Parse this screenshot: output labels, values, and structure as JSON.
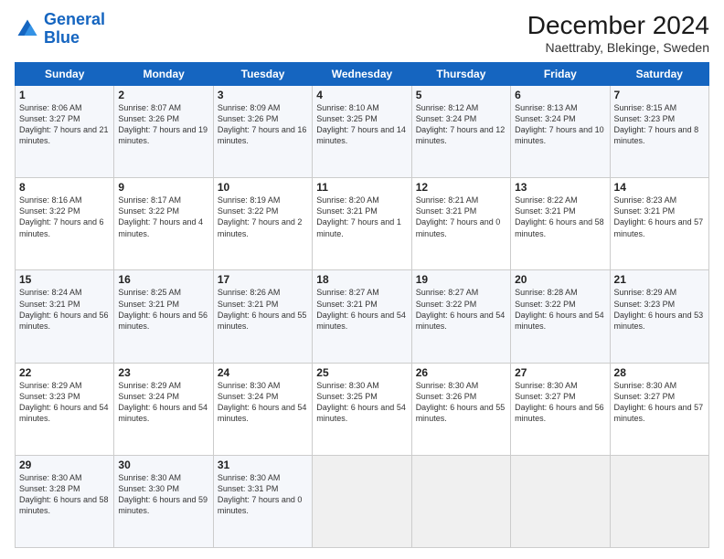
{
  "logo": {
    "line1": "General",
    "line2": "Blue"
  },
  "title": "December 2024",
  "subtitle": "Naettraby, Blekinge, Sweden",
  "days_header": [
    "Sunday",
    "Monday",
    "Tuesday",
    "Wednesday",
    "Thursday",
    "Friday",
    "Saturday"
  ],
  "weeks": [
    [
      {
        "day": "1",
        "sunrise": "Sunrise: 8:06 AM",
        "sunset": "Sunset: 3:27 PM",
        "daylight": "Daylight: 7 hours and 21 minutes."
      },
      {
        "day": "2",
        "sunrise": "Sunrise: 8:07 AM",
        "sunset": "Sunset: 3:26 PM",
        "daylight": "Daylight: 7 hours and 19 minutes."
      },
      {
        "day": "3",
        "sunrise": "Sunrise: 8:09 AM",
        "sunset": "Sunset: 3:26 PM",
        "daylight": "Daylight: 7 hours and 16 minutes."
      },
      {
        "day": "4",
        "sunrise": "Sunrise: 8:10 AM",
        "sunset": "Sunset: 3:25 PM",
        "daylight": "Daylight: 7 hours and 14 minutes."
      },
      {
        "day": "5",
        "sunrise": "Sunrise: 8:12 AM",
        "sunset": "Sunset: 3:24 PM",
        "daylight": "Daylight: 7 hours and 12 minutes."
      },
      {
        "day": "6",
        "sunrise": "Sunrise: 8:13 AM",
        "sunset": "Sunset: 3:24 PM",
        "daylight": "Daylight: 7 hours and 10 minutes."
      },
      {
        "day": "7",
        "sunrise": "Sunrise: 8:15 AM",
        "sunset": "Sunset: 3:23 PM",
        "daylight": "Daylight: 7 hours and 8 minutes."
      }
    ],
    [
      {
        "day": "8",
        "sunrise": "Sunrise: 8:16 AM",
        "sunset": "Sunset: 3:22 PM",
        "daylight": "Daylight: 7 hours and 6 minutes."
      },
      {
        "day": "9",
        "sunrise": "Sunrise: 8:17 AM",
        "sunset": "Sunset: 3:22 PM",
        "daylight": "Daylight: 7 hours and 4 minutes."
      },
      {
        "day": "10",
        "sunrise": "Sunrise: 8:19 AM",
        "sunset": "Sunset: 3:22 PM",
        "daylight": "Daylight: 7 hours and 2 minutes."
      },
      {
        "day": "11",
        "sunrise": "Sunrise: 8:20 AM",
        "sunset": "Sunset: 3:21 PM",
        "daylight": "Daylight: 7 hours and 1 minute."
      },
      {
        "day": "12",
        "sunrise": "Sunrise: 8:21 AM",
        "sunset": "Sunset: 3:21 PM",
        "daylight": "Daylight: 7 hours and 0 minutes."
      },
      {
        "day": "13",
        "sunrise": "Sunrise: 8:22 AM",
        "sunset": "Sunset: 3:21 PM",
        "daylight": "Daylight: 6 hours and 58 minutes."
      },
      {
        "day": "14",
        "sunrise": "Sunrise: 8:23 AM",
        "sunset": "Sunset: 3:21 PM",
        "daylight": "Daylight: 6 hours and 57 minutes."
      }
    ],
    [
      {
        "day": "15",
        "sunrise": "Sunrise: 8:24 AM",
        "sunset": "Sunset: 3:21 PM",
        "daylight": "Daylight: 6 hours and 56 minutes."
      },
      {
        "day": "16",
        "sunrise": "Sunrise: 8:25 AM",
        "sunset": "Sunset: 3:21 PM",
        "daylight": "Daylight: 6 hours and 56 minutes."
      },
      {
        "day": "17",
        "sunrise": "Sunrise: 8:26 AM",
        "sunset": "Sunset: 3:21 PM",
        "daylight": "Daylight: 6 hours and 55 minutes."
      },
      {
        "day": "18",
        "sunrise": "Sunrise: 8:27 AM",
        "sunset": "Sunset: 3:21 PM",
        "daylight": "Daylight: 6 hours and 54 minutes."
      },
      {
        "day": "19",
        "sunrise": "Sunrise: 8:27 AM",
        "sunset": "Sunset: 3:22 PM",
        "daylight": "Daylight: 6 hours and 54 minutes."
      },
      {
        "day": "20",
        "sunrise": "Sunrise: 8:28 AM",
        "sunset": "Sunset: 3:22 PM",
        "daylight": "Daylight: 6 hours and 54 minutes."
      },
      {
        "day": "21",
        "sunrise": "Sunrise: 8:29 AM",
        "sunset": "Sunset: 3:23 PM",
        "daylight": "Daylight: 6 hours and 53 minutes."
      }
    ],
    [
      {
        "day": "22",
        "sunrise": "Sunrise: 8:29 AM",
        "sunset": "Sunset: 3:23 PM",
        "daylight": "Daylight: 6 hours and 54 minutes."
      },
      {
        "day": "23",
        "sunrise": "Sunrise: 8:29 AM",
        "sunset": "Sunset: 3:24 PM",
        "daylight": "Daylight: 6 hours and 54 minutes."
      },
      {
        "day": "24",
        "sunrise": "Sunrise: 8:30 AM",
        "sunset": "Sunset: 3:24 PM",
        "daylight": "Daylight: 6 hours and 54 minutes."
      },
      {
        "day": "25",
        "sunrise": "Sunrise: 8:30 AM",
        "sunset": "Sunset: 3:25 PM",
        "daylight": "Daylight: 6 hours and 54 minutes."
      },
      {
        "day": "26",
        "sunrise": "Sunrise: 8:30 AM",
        "sunset": "Sunset: 3:26 PM",
        "daylight": "Daylight: 6 hours and 55 minutes."
      },
      {
        "day": "27",
        "sunrise": "Sunrise: 8:30 AM",
        "sunset": "Sunset: 3:27 PM",
        "daylight": "Daylight: 6 hours and 56 minutes."
      },
      {
        "day": "28",
        "sunrise": "Sunrise: 8:30 AM",
        "sunset": "Sunset: 3:27 PM",
        "daylight": "Daylight: 6 hours and 57 minutes."
      }
    ],
    [
      {
        "day": "29",
        "sunrise": "Sunrise: 8:30 AM",
        "sunset": "Sunset: 3:28 PM",
        "daylight": "Daylight: 6 hours and 58 minutes."
      },
      {
        "day": "30",
        "sunrise": "Sunrise: 8:30 AM",
        "sunset": "Sunset: 3:30 PM",
        "daylight": "Daylight: 6 hours and 59 minutes."
      },
      {
        "day": "31",
        "sunrise": "Sunrise: 8:30 AM",
        "sunset": "Sunset: 3:31 PM",
        "daylight": "Daylight: 7 hours and 0 minutes."
      },
      null,
      null,
      null,
      null
    ]
  ]
}
